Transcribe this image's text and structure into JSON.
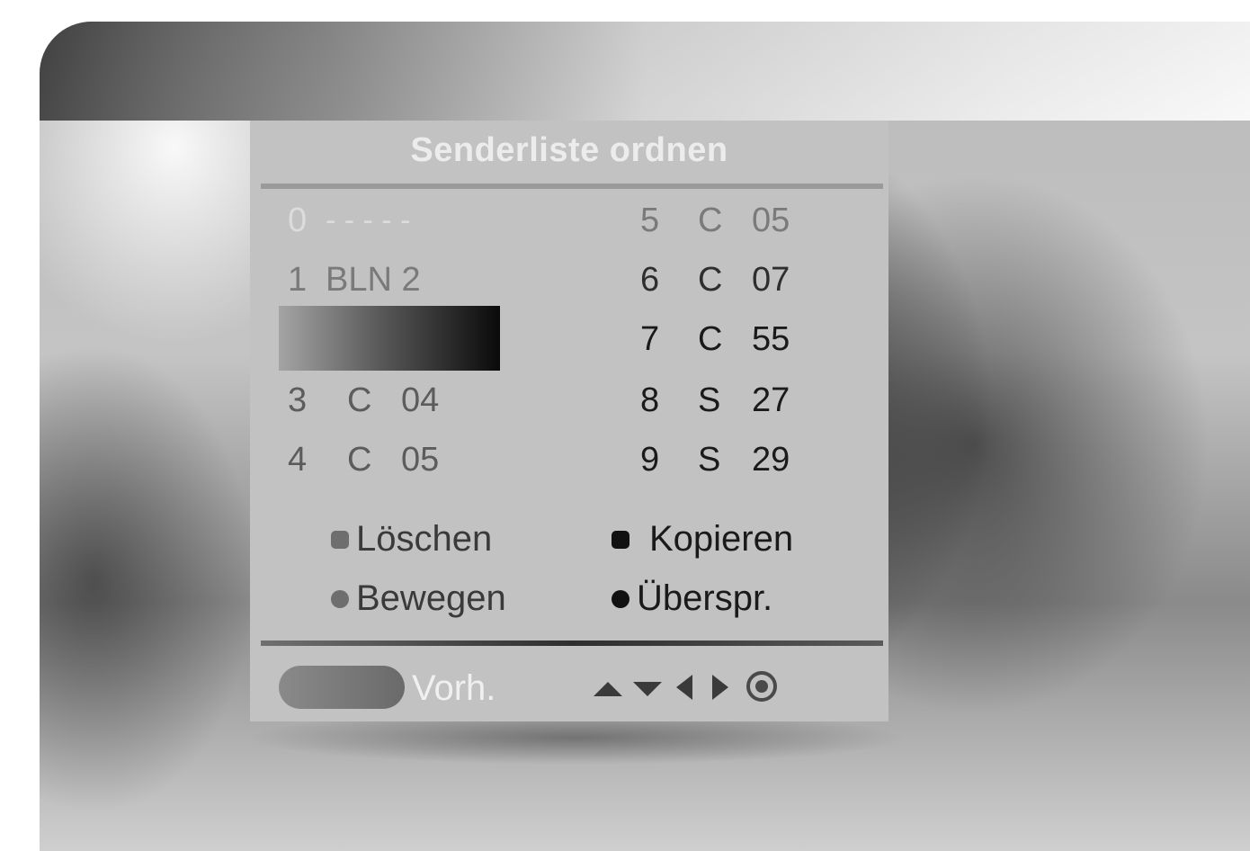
{
  "title": "Senderliste ordnen",
  "channels_left": [
    {
      "num": "0",
      "band": "",
      "name": "- - - - -"
    },
    {
      "num": "1",
      "band": "",
      "name": "BLN 2"
    },
    {
      "num": "",
      "band": "",
      "name": ""
    },
    {
      "num": "3",
      "band": "C",
      "name": "04"
    },
    {
      "num": "4",
      "band": "C",
      "name": "05"
    }
  ],
  "channels_right": [
    {
      "num": "5",
      "band": "C",
      "name": "05"
    },
    {
      "num": "6",
      "band": "C",
      "name": "07"
    },
    {
      "num": "7",
      "band": "C",
      "name": "55"
    },
    {
      "num": "8",
      "band": "S",
      "name": "27"
    },
    {
      "num": "9",
      "band": "S",
      "name": "29"
    }
  ],
  "legend": {
    "delete": "Löschen",
    "copy": "Kopieren",
    "move": "Bewegen",
    "skip": "Überspr."
  },
  "footer": {
    "prev_label": "Vorh."
  },
  "icons": {
    "up": "triangle-up-icon",
    "down": "triangle-down-icon",
    "left": "triangle-left-icon",
    "right": "triangle-right-icon",
    "ok": "ok-button-icon"
  }
}
